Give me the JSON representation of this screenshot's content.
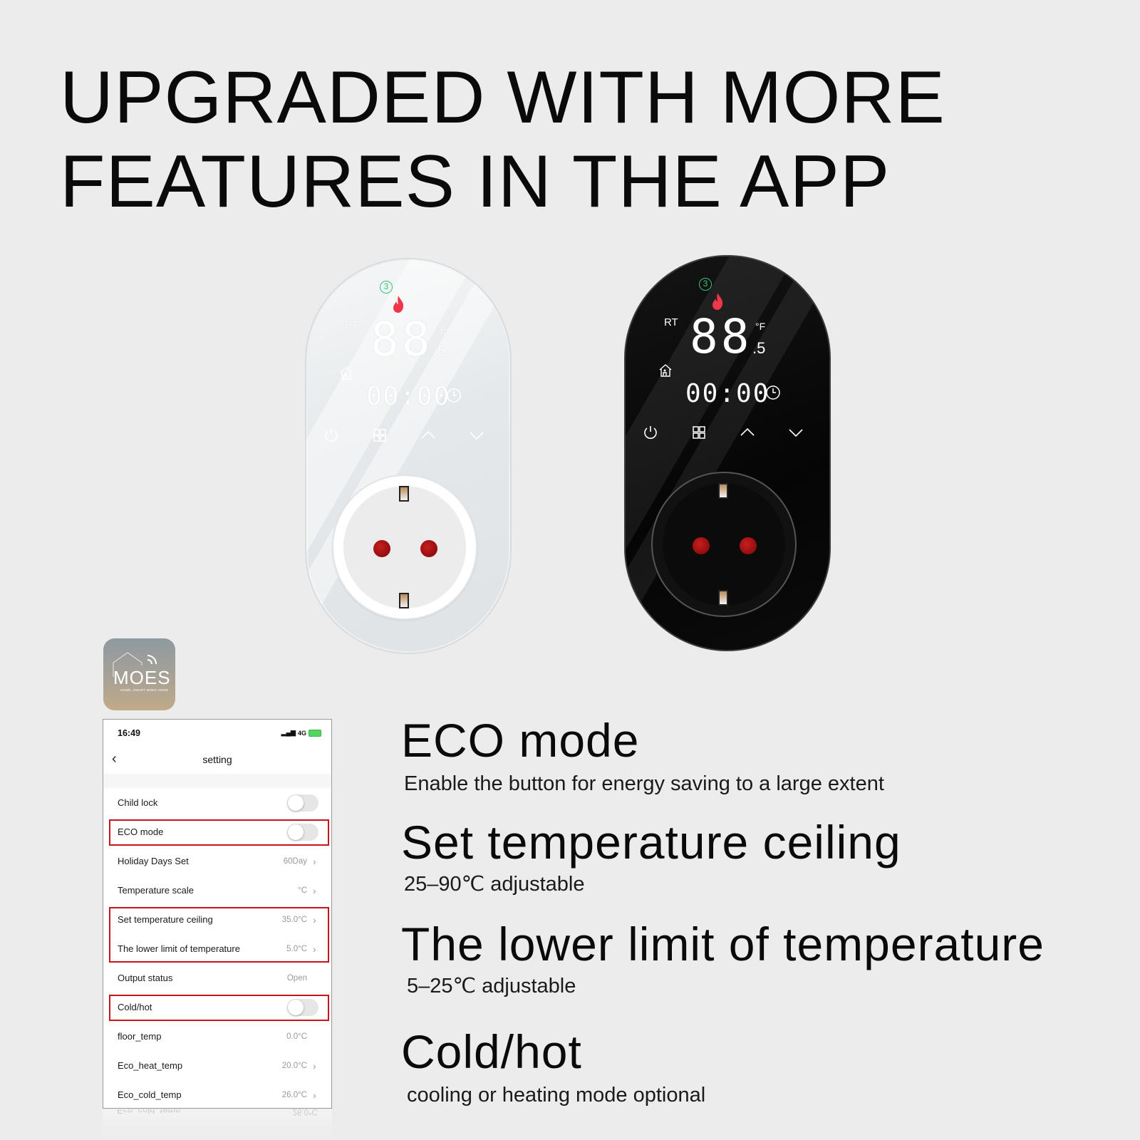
{
  "headline": {
    "line1": "UPGRADED WITH MORE",
    "line2": "FEATURES IN THE APP"
  },
  "devices": [
    {
      "variant": "white",
      "mode_badge": "3",
      "rt_label": "RT",
      "temp_digits": "88",
      "temp_unit": "°F",
      "temp_decimal": ".5",
      "time_display": "00:00",
      "buttons": [
        "power-icon",
        "menu-grid-icon",
        "chevron-up-icon",
        "chevron-down-icon"
      ]
    },
    {
      "variant": "black",
      "mode_badge": "3",
      "rt_label": "RT",
      "temp_digits": "88",
      "temp_unit": "°F",
      "temp_decimal": ".5",
      "time_display": "00:00",
      "buttons": [
        "power-icon",
        "menu-grid-icon",
        "chevron-up-icon",
        "chevron-down-icon"
      ]
    }
  ],
  "app_icon": {
    "brand": "MOES",
    "tagline": "HOME, SMART MOES HOME"
  },
  "phone": {
    "status_time": "16:49",
    "network": "4G",
    "nav_title": "setting",
    "rows": [
      {
        "label": "Child lock",
        "type": "toggle",
        "on": false
      },
      {
        "label": "ECO mode",
        "type": "toggle",
        "on": false,
        "highlighted": true
      },
      {
        "label": "Holiday Days Set",
        "type": "value",
        "value": "60Day",
        "chevron": true
      },
      {
        "label": "Temperature scale",
        "type": "value",
        "value": "°C",
        "chevron": true
      },
      {
        "label": "Set temperature ceiling",
        "type": "value",
        "value": "35.0°C",
        "chevron": true,
        "highlighted": true
      },
      {
        "label": "The lower limit of temperature",
        "type": "value",
        "value": "5.0°C",
        "chevron": true,
        "highlighted": true
      },
      {
        "label": "Output status",
        "type": "value",
        "value": "Open",
        "chevron": false
      },
      {
        "label": "Cold/hot",
        "type": "toggle",
        "on": false,
        "highlighted": true
      },
      {
        "label": "floor_temp",
        "type": "value",
        "value": "0.0°C",
        "chevron": false
      },
      {
        "label": "Eco_heat_temp",
        "type": "value",
        "value": "20.0°C",
        "chevron": true
      },
      {
        "label": "Eco_cold_temp",
        "type": "value",
        "value": "26.0°C",
        "chevron": true
      }
    ],
    "highlight_color": "#c8141b"
  },
  "features": [
    {
      "title": "ECO mode",
      "description": "Enable the button for energy saving to a large extent"
    },
    {
      "title": "Set temperature ceiling",
      "description": "25–90℃ adjustable"
    },
    {
      "title": "The lower limit of temperature",
      "description": "5–25℃ adjustable"
    },
    {
      "title": "Cold/hot",
      "description": "cooling or heating mode optional"
    }
  ]
}
